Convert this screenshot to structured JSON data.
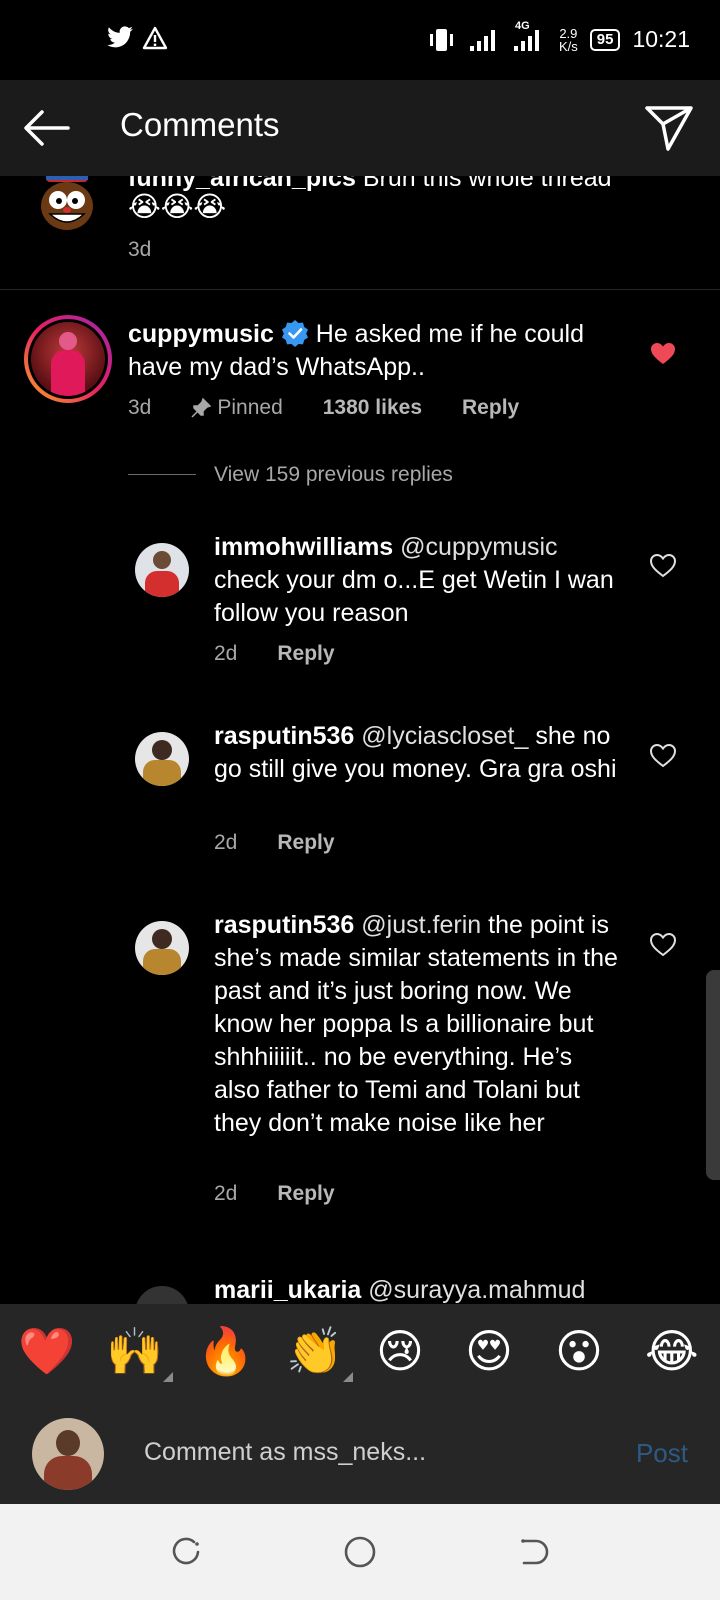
{
  "status_bar": {
    "network": "4G",
    "speed_value": "2.9",
    "speed_unit": "K/s",
    "battery": "95",
    "time": "10:21"
  },
  "header": {
    "title": "Comments"
  },
  "comments": [
    {
      "username": "funny_african_pics",
      "text": "Brun this whole thread",
      "emojis": "😭😭😭",
      "age": "3d"
    },
    {
      "username": "cuppymusic",
      "text": "He asked me if he could have my dad’s WhatsApp..",
      "age": "3d",
      "pinned": "Pinned",
      "likes": "1380 likes",
      "reply": "Reply",
      "liked_color": "#ed4956"
    }
  ],
  "view_previous": "View 159 previous replies",
  "replies": [
    {
      "username": "immohwilliams",
      "mention": "@cuppymusic",
      "text": "check your dm o...E get Wetin I wan follow you reason",
      "age": "2d",
      "reply": "Reply"
    },
    {
      "username": "rasputin536",
      "mention": "@lyciascloset_",
      "text": "she no go still give you money. Gra gra oshi",
      "age": "2d",
      "reply": "Reply"
    },
    {
      "username": "rasputin536",
      "mention": "@just.ferin",
      "text": "the point is she’s made similar statements in the past and it’s just boring now. We know her poppa Is a billionaire but shhhiiiiit.. no be everything. He’s also father to Temi and Tolani but they don’t make noise like her",
      "age": "2d",
      "reply": "Reply"
    },
    {
      "username": "marii_ukaria",
      "mention": "@surayya.mahmud"
    }
  ],
  "emoji_bar": [
    "❤️",
    "🙌",
    "🔥",
    "👏",
    "😢",
    "😍",
    "😮",
    "😂"
  ],
  "input": {
    "placeholder": "Comment as mss_neks...",
    "post_label": "Post"
  },
  "icons": {
    "back": "arrow-left-icon",
    "share": "send-icon",
    "verified": "verified-badge-icon",
    "pin": "pin-icon",
    "heart": "heart-icon"
  }
}
